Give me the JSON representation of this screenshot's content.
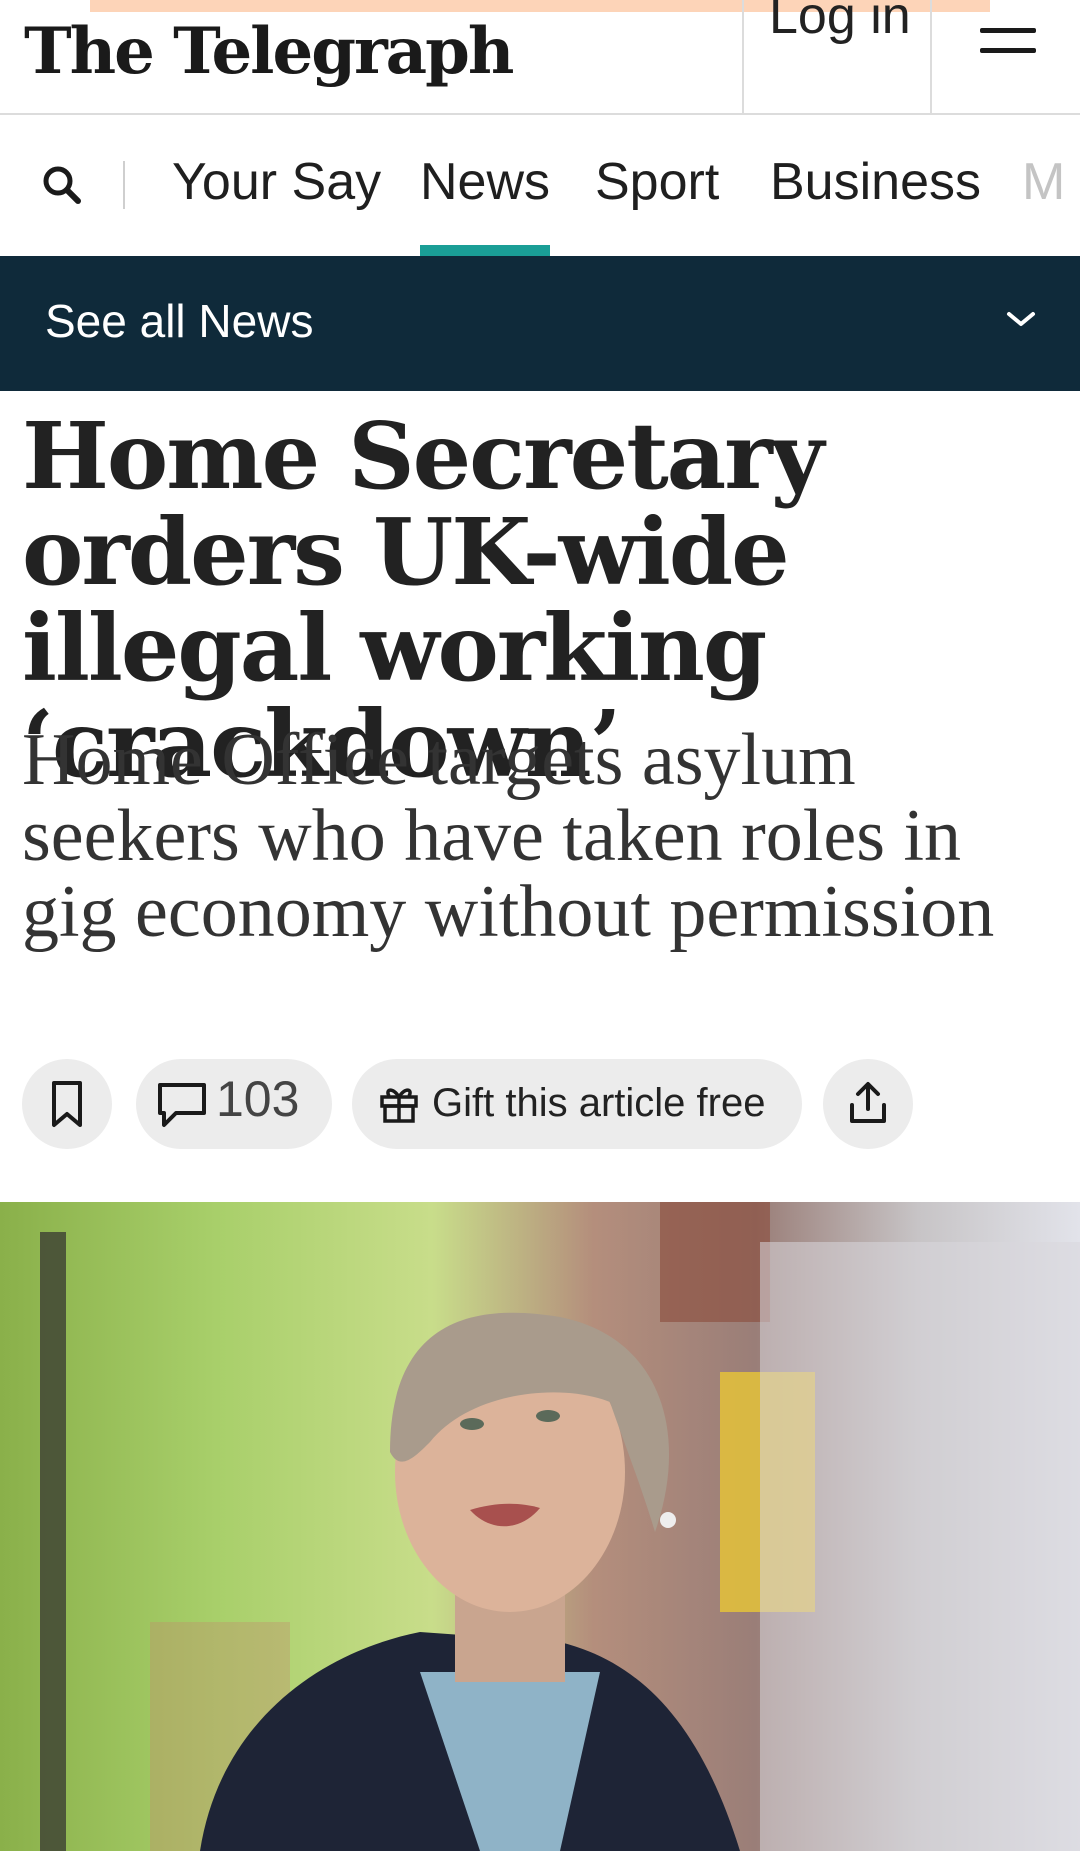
{
  "masthead": {
    "logo_text": "The Telegraph",
    "login_label": "Log in",
    "menu_icon": "hamburger-menu-icon"
  },
  "nav": {
    "search_icon": "search-icon",
    "items": [
      {
        "label": "Your Say",
        "active": false
      },
      {
        "label": "News",
        "active": true
      },
      {
        "label": "Sport",
        "active": false
      },
      {
        "label": "Business",
        "active": false
      },
      {
        "label": "M",
        "active": false
      }
    ],
    "accent_color": "#1a9e96"
  },
  "subnav": {
    "label": "See all News",
    "icon": "chevron-down-icon",
    "background_color": "#0f2a3a"
  },
  "article": {
    "headline": "Home Secretary orders UK-wide illegal working ‘crackdown’",
    "standfirst": "Home Office targets asylum seekers who have taken roles in gig economy without permission",
    "actions": {
      "bookmark_icon": "bookmark-icon",
      "comments_icon": "comment-icon",
      "comments_count": "103",
      "gift_icon": "gift-icon",
      "gift_label": "Gift this article free",
      "share_icon": "share-icon"
    },
    "hero_image": "photo-woman-short-grey-hair-street"
  }
}
